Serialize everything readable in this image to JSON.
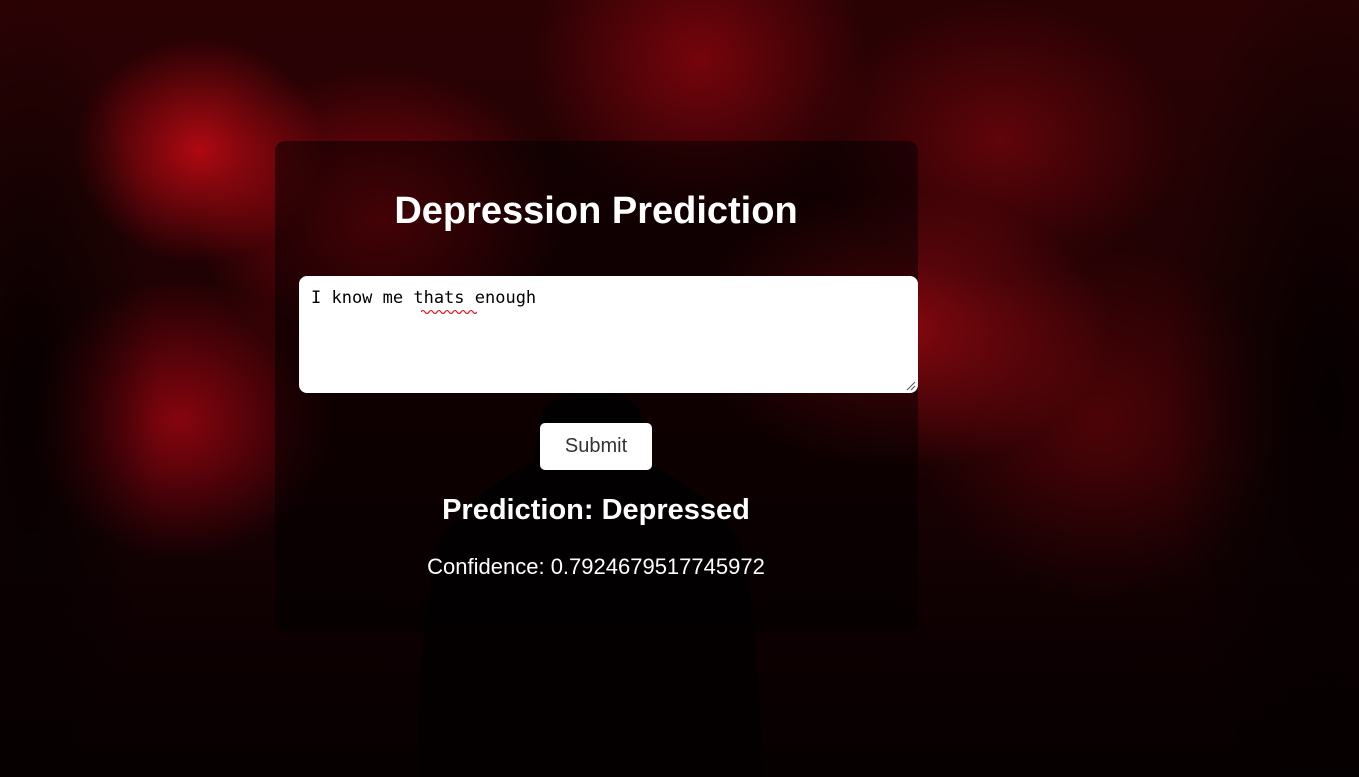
{
  "app": {
    "title": "Depression Prediction"
  },
  "form": {
    "text_value": "I know me thats enough",
    "misspelled_word": "thats",
    "submit_label": "Submit"
  },
  "result": {
    "prediction_text": "Prediction: Depressed",
    "confidence_text": "Confidence: 0.7924679517745972"
  },
  "colors": {
    "card_background": "rgba(0,0,0,0.5)",
    "text_color": "#ffffff",
    "accent_red": "#b0101a",
    "button_background": "#ffffff"
  },
  "icons": {
    "resize": "resize-grip-icon",
    "spellcheck": "spellcheck-squiggle-icon"
  }
}
